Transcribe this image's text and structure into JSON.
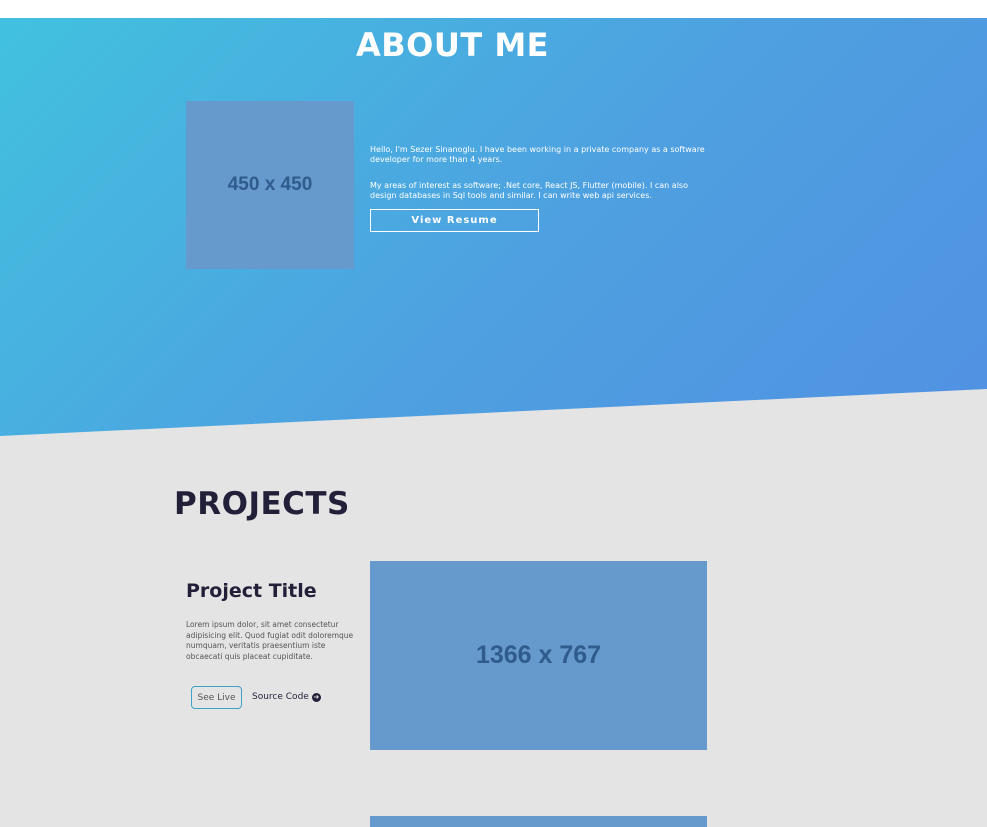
{
  "about": {
    "title": "ABOUT ME",
    "image_label": "450 x 450",
    "paragraph1": "Hello, I'm Sezer Sinanoglu. I have been working in a private company as a software developer for more than 4 years.",
    "paragraph2": "My areas of interest as software; .Net core, React JS, Flutter (mobile). I can also design databases in Sql tools and similar. I can write web api services.",
    "resume_label": "View Resume"
  },
  "projects": {
    "title": "PROJECTS",
    "items": [
      {
        "title": "Project Title",
        "description": "Lorem ipsum dolor, sit amet consectetur adipisicing elit. Quod fugiat odit doloremque numquam, veritatis praesentium iste obcaecati quis placeat cupiditate.",
        "see_live_label": "See Live",
        "source_code_label": "Source Code",
        "source_code_icon": "arrow-circle-right-icon",
        "image_label": "1366 x 767"
      }
    ]
  },
  "colors": {
    "gradient_start": "#41c1df",
    "gradient_end": "#5191e2",
    "placeholder_bg": "#6699cc",
    "heading_dark": "#221f38",
    "page_bg": "#e4e4e4"
  }
}
